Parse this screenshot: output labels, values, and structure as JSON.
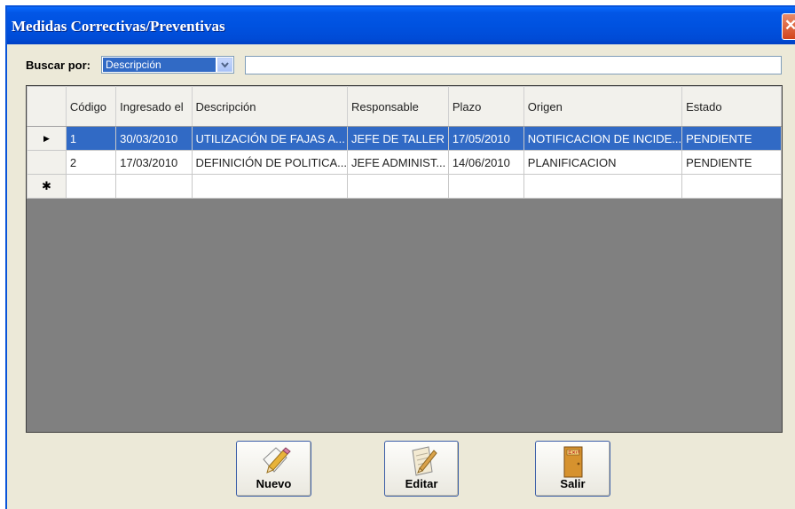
{
  "window": {
    "title": "Medidas Correctivas/Preventivas"
  },
  "search": {
    "label": "Buscar por:",
    "field_value": "Descripción",
    "text_value": ""
  },
  "grid": {
    "columns": [
      "Código",
      "Ingresado el",
      "Descripción",
      "Responsable",
      "Plazo",
      "Origen",
      "Estado"
    ],
    "rows": [
      {
        "codigo": "1",
        "ingresado": "30/03/2010",
        "descripcion": "UTILIZACIÓN DE FAJAS A...",
        "responsable": "JEFE DE TALLER",
        "plazo": "17/05/2010",
        "origen": "NOTIFICACION DE INCIDE...",
        "estado": "PENDIENTE"
      },
      {
        "codigo": "2",
        "ingresado": "17/03/2010",
        "descripcion": "DEFINICIÓN DE POLITICA...",
        "responsable": "JEFE ADMINIST...",
        "plazo": "14/06/2010",
        "origen": "PLANIFICACION",
        "estado": "PENDIENTE"
      }
    ],
    "current_row_marker": "▶",
    "new_row_marker": "✱"
  },
  "buttons": {
    "nuevo": "Nuevo",
    "editar": "Editar",
    "salir": "Salir"
  },
  "icons": {
    "close": "close-icon",
    "dropdown": "chevron-down-icon",
    "nuevo": "pencil-document-icon",
    "editar": "edit-document-icon",
    "salir": "exit-door-icon"
  },
  "colors": {
    "titlebar": "#0054e3",
    "selection": "#316ac5",
    "grid_background": "#808080",
    "dialog_background": "#ece9d8"
  }
}
